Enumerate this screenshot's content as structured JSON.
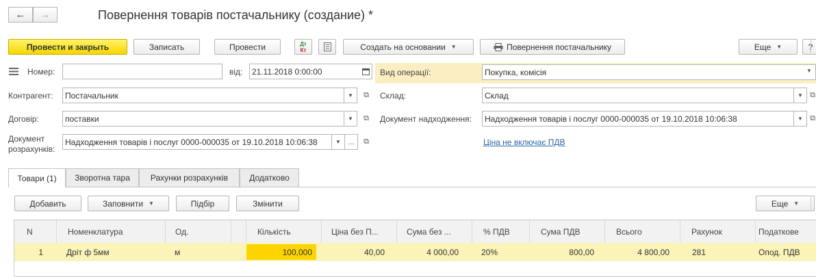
{
  "window": {
    "title": "Повернення товарів постачальнику (создание) *",
    "back_icon": "←",
    "forward_icon": "→"
  },
  "toolbar": {
    "post_close": "Провести и закрыть",
    "save": "Записать",
    "post": "Провести",
    "dtkt_icon_top": "Дт",
    "dtkt_icon_bottom": "Кт",
    "create_based": "Создать на основании",
    "print_return": "Повернення постачальнику",
    "more": "Еще",
    "help": "?"
  },
  "form": {
    "number_label": "Номер:",
    "number_value": "",
    "date_label": "від:",
    "date_value": "21.11.2018  0:00:00",
    "counterparty_label": "Контрагент:",
    "counterparty_value": "Постачальник",
    "contract_label": "Договір:",
    "contract_value": "поставки",
    "settlement_doc_label_1": "Документ",
    "settlement_doc_label_2": "розрахунків:",
    "settlement_doc_value": "Надходження товарів і послуг 0000-000035 от 19.10.2018 10:06:38",
    "operation_label": "Вид операції:",
    "operation_value": "Покупка, комісія",
    "warehouse_label": "Склад:",
    "warehouse_value": "Склад",
    "receipt_doc_label": "Документ надходження:",
    "receipt_doc_value": "Надходження товарів і послуг 0000-000035 от 19.10.2018 10:06:38",
    "vat_link": "Ціна не включає ПДВ"
  },
  "tabs": [
    {
      "label": "Товари (1)"
    },
    {
      "label": "Зворотна тара"
    },
    {
      "label": "Рахунки розрахунків"
    },
    {
      "label": "Додатково"
    }
  ],
  "table_toolbar": {
    "add": "Добавить",
    "fill": "Заповнити",
    "select": "Підбір",
    "change": "Змінити",
    "more": "Еще"
  },
  "table": {
    "headers": [
      "N",
      "Номенклатура",
      "Од.",
      "",
      "Кількість",
      "Ціна без П...",
      "Сума без ...",
      "% ПДВ",
      "Сума ПДВ",
      "Всього",
      "Рахунок",
      "Податкове"
    ],
    "rows": [
      [
        "1",
        "Дріт ф 5мм",
        "м",
        "",
        "100,000",
        "40,00",
        "4 000,00",
        "20%",
        "800,00",
        "4 800,00",
        "281",
        "Опод. ПДВ"
      ]
    ]
  },
  "colors": {
    "primary_button": "#f4d600",
    "highlight_row": "#fbf4b8",
    "active_cell": "#fcd500",
    "operation_bg": "#fbeec2",
    "link": "#2b65a8"
  }
}
